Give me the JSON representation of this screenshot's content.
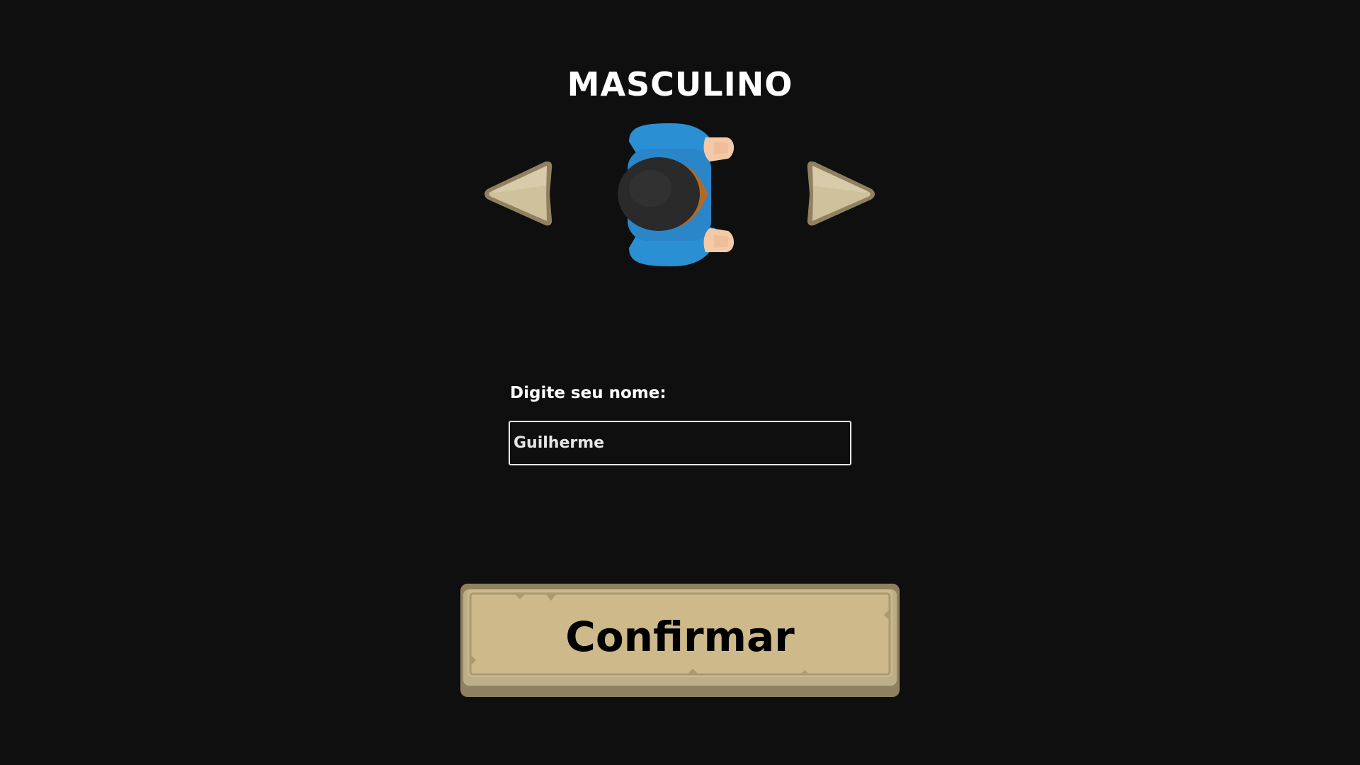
{
  "character_select": {
    "gender_label": "MASCULINO",
    "prev_icon": "arrow-left-icon",
    "next_icon": "arrow-right-icon",
    "character_sprite": "male-character-sprite"
  },
  "name_form": {
    "label": "Digite seu nome:",
    "input_value": "Guilherme"
  },
  "confirm": {
    "label": "Confirmar"
  },
  "colors": {
    "background": "#0f0f10",
    "button_parchment": "#cdb98a",
    "button_border": "#8f8160",
    "arrow_fill": "#cfc19c",
    "shirt_blue": "#2b8fd4",
    "hair": "#2a2a2a",
    "skin": "#f3c9a6"
  }
}
